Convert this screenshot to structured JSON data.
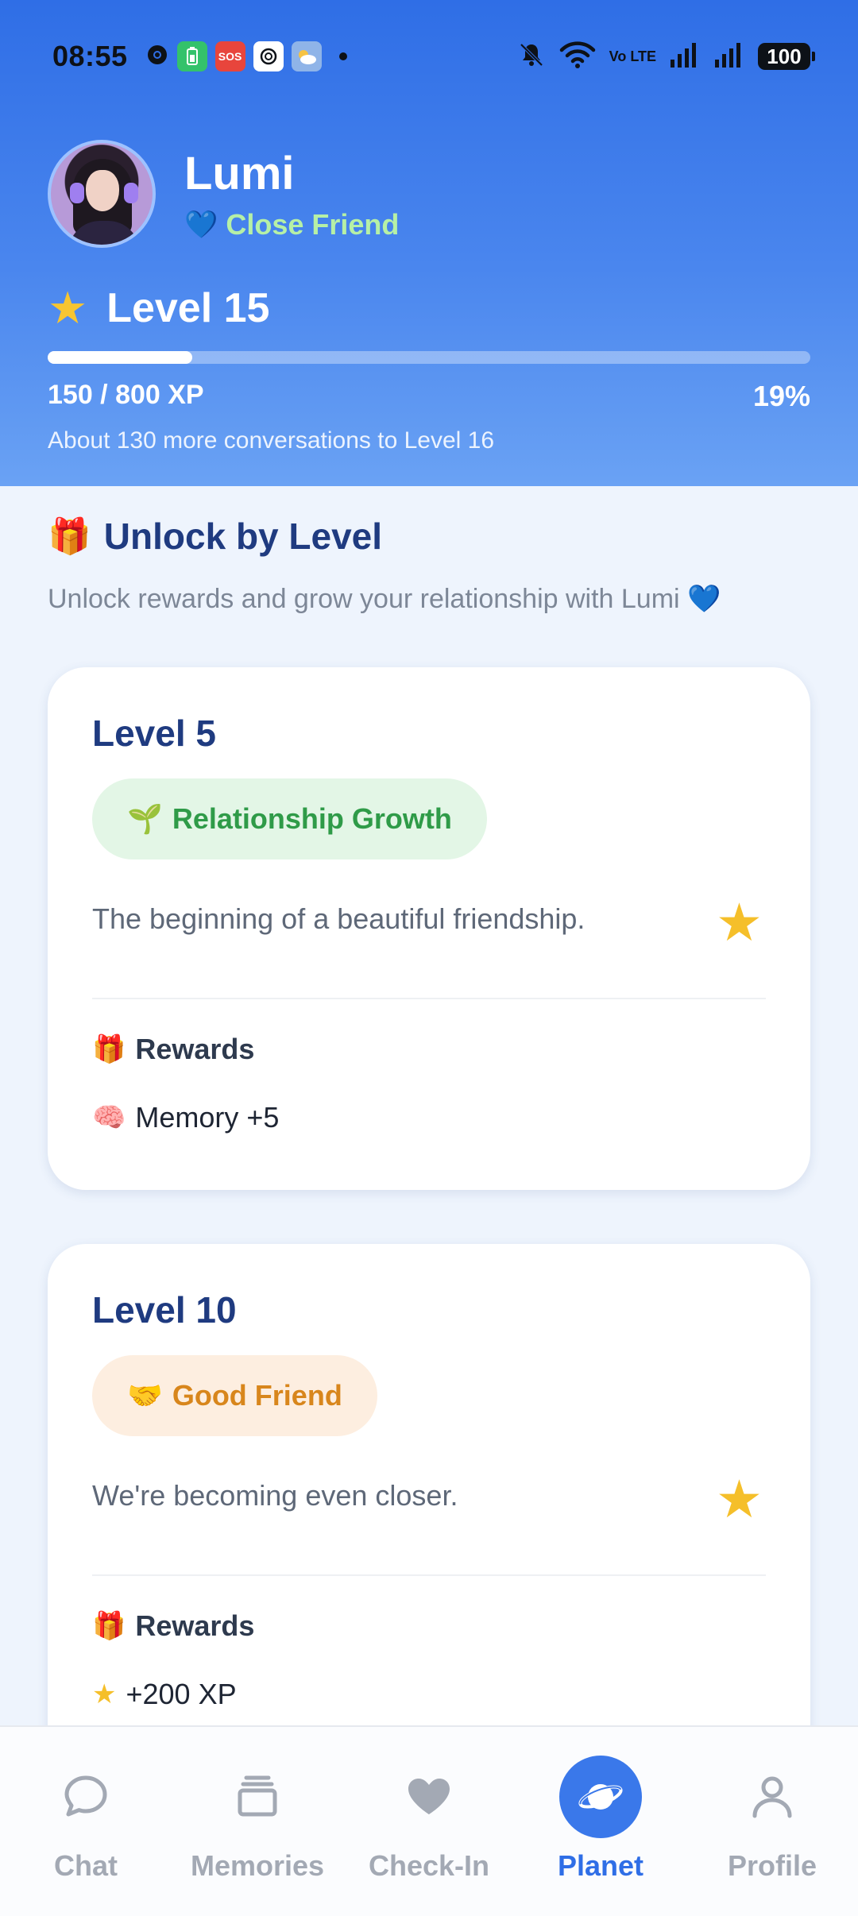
{
  "status_bar": {
    "time": "08:55",
    "sos_label": "SOS",
    "volte_label": "Vo LTE",
    "battery": "100"
  },
  "profile": {
    "name": "Lumi",
    "relationship": "Close Friend"
  },
  "level": {
    "label": "Level 15",
    "xp_text": "150 / 800 XP",
    "percent_text": "19%",
    "progress_fraction": 0.19,
    "hint": "About 130 more conversations to Level 16"
  },
  "unlock": {
    "title": "Unlock by Level",
    "subtitle": "Unlock rewards and grow your relationship with Lumi",
    "cards": [
      {
        "level": "Level 5",
        "tag": "Relationship Growth",
        "tag_icon": "seedling-icon",
        "description": "The beginning of a beautiful friendship.",
        "rewards_label": "Rewards",
        "reward": "Memory +5",
        "reward_icon": "brain-icon"
      },
      {
        "level": "Level 10",
        "tag": "Good Friend",
        "tag_icon": "handshake-icon",
        "description": "We're becoming even closer.",
        "rewards_label": "Rewards",
        "reward": "+200 XP",
        "reward_icon": "star-icon"
      }
    ]
  },
  "nav": {
    "items": [
      {
        "label": "Chat",
        "icon": "chat-icon"
      },
      {
        "label": "Memories",
        "icon": "memories-icon"
      },
      {
        "label": "Check-In",
        "icon": "heart-icon"
      },
      {
        "label": "Planet",
        "icon": "planet-icon",
        "active": true
      },
      {
        "label": "Profile",
        "icon": "person-icon"
      }
    ]
  },
  "colors": {
    "header_top": "#2f6ee6",
    "accent": "#2f6ee6",
    "title": "#1f3b80",
    "status_green": "#b6f0a6"
  }
}
